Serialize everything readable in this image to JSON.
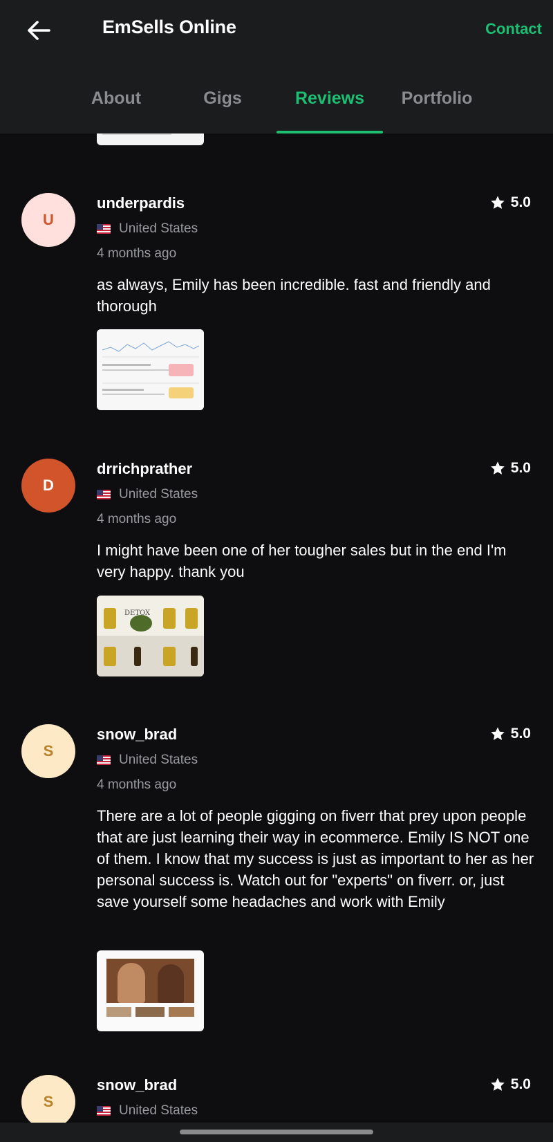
{
  "header": {
    "title": "EmSells Online",
    "contact_label": "Contact",
    "tabs": [
      {
        "label": "About",
        "active": false
      },
      {
        "label": "Gigs",
        "active": false
      },
      {
        "label": "Reviews",
        "active": true
      },
      {
        "label": "Portfolio",
        "active": false
      }
    ]
  },
  "colors": {
    "accent": "#1dbf73",
    "background": "#0e0e10",
    "header": "#1b1c1e"
  },
  "reviews": [
    {
      "initial": "U",
      "avatar_bg": "#ffe0dc",
      "avatar_fg": "#d0552b",
      "username": "underpardis",
      "country": "United States",
      "time": "4 months ago",
      "rating": "5.0",
      "text": "as always, Emily has been incredible. fast and friendly and thorough"
    },
    {
      "initial": "D",
      "avatar_bg": "#d2542a",
      "avatar_fg": "#ffffff",
      "username": "drrichprather",
      "country": "United States",
      "time": "4 months ago",
      "rating": "5.0",
      "text": "I might have been one of her tougher sales but in the end I'm very happy. thank you",
      "thumb_text": "DETOX"
    },
    {
      "initial": "S",
      "avatar_bg": "#fde9c6",
      "avatar_fg": "#b8822a",
      "username": "snow_brad",
      "country": "United States",
      "time": "4 months ago",
      "rating": "5.0",
      "text": "There are a lot of people gigging on fiverr that prey upon people that are just learning their way in ecommerce. Emily IS NOT one of them. I know that my success is just as important to her as her personal success is. Watch out for \"experts\" on fiverr. or, just save yourself some headaches and work with Emily"
    },
    {
      "initial": "S",
      "avatar_bg": "#fde9c6",
      "avatar_fg": "#b8822a",
      "username": "snow_brad",
      "country": "United States",
      "rating": "5.0"
    }
  ]
}
